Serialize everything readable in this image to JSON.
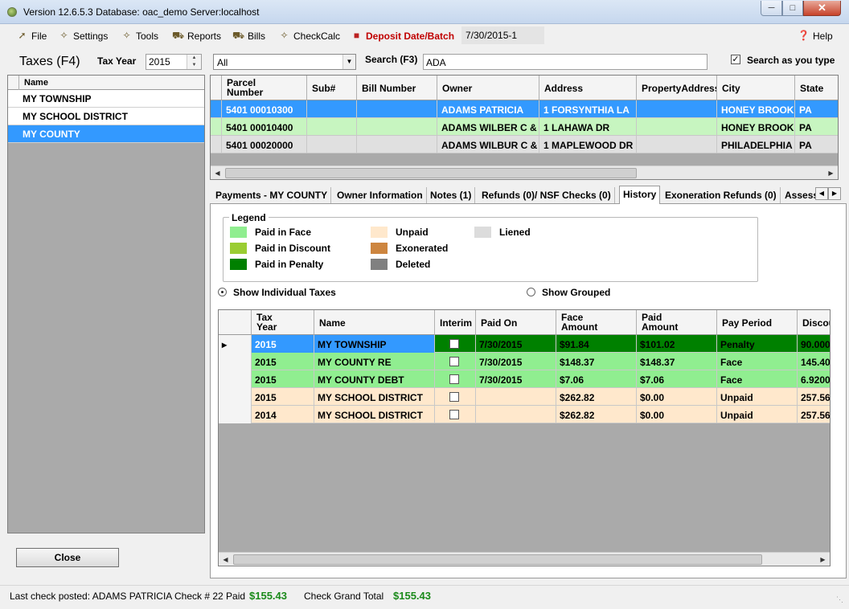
{
  "window": {
    "title": "Version 12.6.5.3 Database: oac_demo Server:localhost"
  },
  "menu": {
    "file": "File",
    "settings": "Settings",
    "tools": "Tools",
    "reports": "Reports",
    "bills": "Bills",
    "checkcalc": "CheckCalc",
    "deposit": "Deposit Date/Batch",
    "deposit_value": "7/30/2015-1",
    "help": "Help"
  },
  "left": {
    "title": "Taxes (F4)",
    "tax_year_label": "Tax Year",
    "tax_year": "2015",
    "name_header": "Name",
    "items": [
      {
        "name": "MY TOWNSHIP"
      },
      {
        "name": "MY SCHOOL DISTRICT"
      },
      {
        "name": "MY COUNTY"
      }
    ],
    "close_label": "Close"
  },
  "search": {
    "filter": "All",
    "label": "Search (F3)",
    "value": "ADA",
    "search_as_you_type": "Search as you type"
  },
  "parcels": {
    "headers": [
      "Parcel\nNumber",
      "Sub#",
      "Bill Number",
      "Owner",
      "Address",
      "PropertyAddress",
      "City",
      "State"
    ],
    "rows": [
      [
        "5401 00010300",
        "",
        "",
        "ADAMS PATRICIA",
        "1 FORSYNTHIA LA",
        "",
        "HONEY BROOK",
        "PA"
      ],
      [
        "5401 00010400",
        "",
        "",
        "ADAMS WILBER C &",
        "1 LAHAWA DR",
        "",
        "HONEY BROOK",
        "PA"
      ],
      [
        "5401 00020000",
        "",
        "",
        "ADAMS WILBUR C &",
        "1 MAPLEWOOD DR",
        "",
        "PHILADELPHIA",
        "PA"
      ]
    ]
  },
  "tabs": [
    "Payments - MY COUNTY",
    "Owner Information",
    "Notes (1)",
    "Refunds (0)/ NSF Checks (0)",
    "History",
    "Exoneration Refunds (0)",
    "Assess"
  ],
  "legend": {
    "title": "Legend",
    "items": [
      {
        "label": "Paid in Face",
        "color": "#90ee90"
      },
      {
        "label": "Paid in Discount",
        "color": "#9acd32"
      },
      {
        "label": "Paid in Penalty",
        "color": "#008000"
      },
      {
        "label": "Unpaid",
        "color": "#ffe8cc"
      },
      {
        "label": "Exonerated",
        "color": "#cd853f"
      },
      {
        "label": "Deleted",
        "color": "#808080"
      },
      {
        "label": "Liened",
        "color": "#dcdcdc"
      }
    ]
  },
  "view": {
    "individual": "Show Individual Taxes",
    "grouped": "Show Grouped"
  },
  "history": {
    "headers": [
      "Tax\nYear",
      "Name",
      "Interim",
      "Paid On",
      "Face\nAmount",
      "Paid\nAmount",
      "Pay Period",
      "Discou"
    ],
    "rows": [
      {
        "year": "2015",
        "name": "MY TOWNSHIP",
        "paid_on": "7/30/2015",
        "face": "$91.84",
        "paid": "$101.02",
        "period": "Penalty",
        "disc": "90.000",
        "status": "penalty"
      },
      {
        "year": "2015",
        "name": "MY COUNTY  RE",
        "paid_on": "7/30/2015",
        "face": "$148.37",
        "paid": "$148.37",
        "period": "Face",
        "disc": "145.40",
        "status": "face"
      },
      {
        "year": "2015",
        "name": "MY COUNTY DEBT",
        "paid_on": "7/30/2015",
        "face": "$7.06",
        "paid": "$7.06",
        "period": "Face",
        "disc": "6.9200",
        "status": "face"
      },
      {
        "year": "2015",
        "name": "MY SCHOOL DISTRICT",
        "paid_on": "",
        "face": "$262.82",
        "paid": "$0.00",
        "period": "Unpaid",
        "disc": "257.56",
        "status": "unpaid"
      },
      {
        "year": "2014",
        "name": "MY SCHOOL DISTRICT",
        "paid_on": "",
        "face": "$262.82",
        "paid": "$0.00",
        "period": "Unpaid",
        "disc": "257.56",
        "status": "unpaid"
      }
    ]
  },
  "status": {
    "last_check": "Last check posted:  ADAMS PATRICIA Check # 22 Paid",
    "last_amount": "$155.43",
    "grand_label": "Check Grand Total",
    "grand_amount": "$155.43"
  }
}
